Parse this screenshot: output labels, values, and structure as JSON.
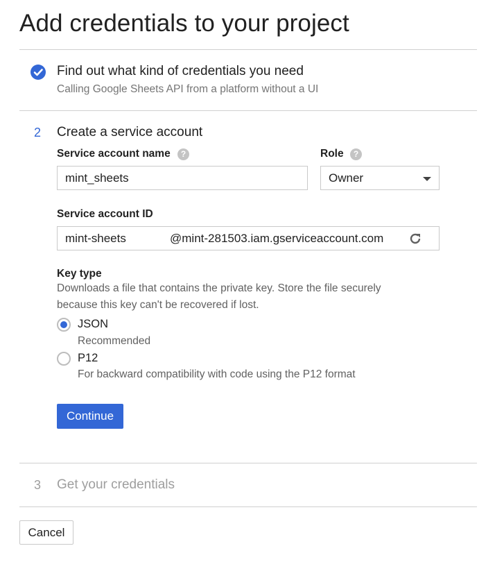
{
  "page": {
    "title": "Add credentials to your project"
  },
  "step1": {
    "title": "Find out what kind of credentials you need",
    "subtitle": "Calling Google Sheets API from a platform without a UI",
    "icon": "check-circle-icon",
    "status_color": "#3367d6"
  },
  "step2": {
    "number": "2",
    "title": "Create a service account",
    "service_account_name": {
      "label": "Service account name",
      "value": "mint_sheets"
    },
    "role": {
      "label": "Role",
      "value": "Owner"
    },
    "service_account_id": {
      "label": "Service account ID",
      "value": "mint-sheets",
      "suffix": "@mint-281503.iam.gserviceaccount.com"
    },
    "key_type": {
      "label": "Key type",
      "description_line1": "Downloads a file that contains the private key. Store the file securely",
      "description_line2": "because this key can't be recovered if lost.",
      "options": [
        {
          "label": "JSON",
          "description": "Recommended",
          "selected": true
        },
        {
          "label": "P12",
          "description": "For backward compatibility with code using the P12 format",
          "selected": false
        }
      ]
    },
    "continue_label": "Continue"
  },
  "step3": {
    "number": "3",
    "title": "Get your credentials"
  },
  "footer": {
    "cancel_label": "Cancel"
  },
  "colors": {
    "accent": "#3367d6",
    "divider": "#cfcfcf",
    "muted_text": "#757575",
    "disabled_text": "#9e9e9e"
  },
  "icons": {
    "help": "help-icon",
    "refresh": "refresh-icon",
    "dropdown": "chevron-down-icon"
  }
}
